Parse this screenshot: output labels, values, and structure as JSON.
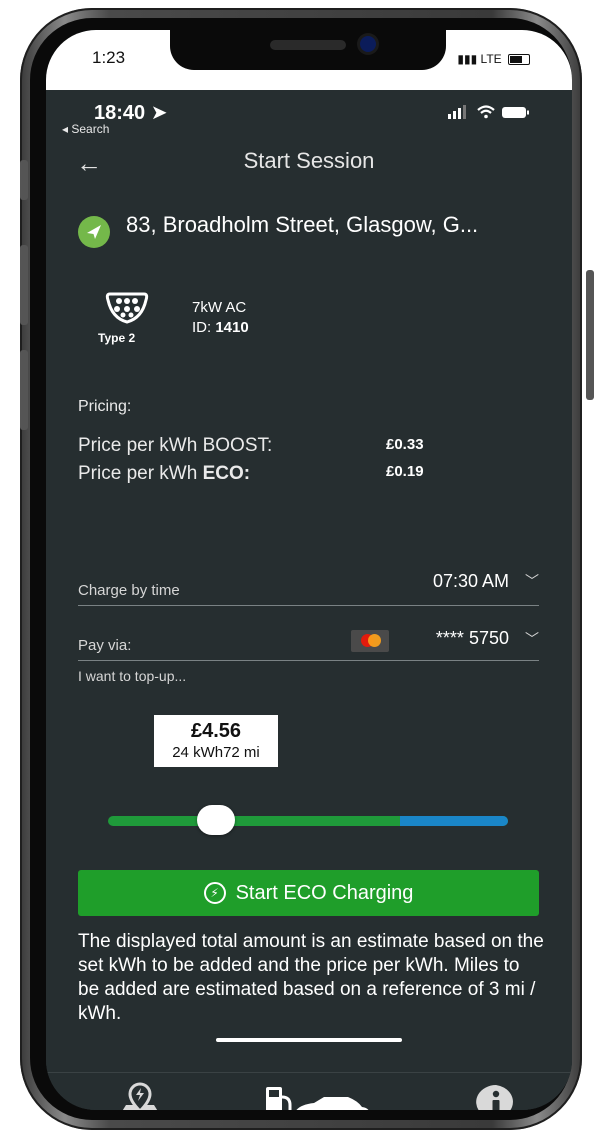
{
  "outer_status": {
    "time": "1:23",
    "right": "LTE"
  },
  "status": {
    "time": "18:40",
    "back_label": "◂ Search"
  },
  "header": {
    "title": "Start Session"
  },
  "location": {
    "address": "83, Broadholm Street, Glasgow, G..."
  },
  "connector": {
    "type_label": "Type 2",
    "power": "7kW AC",
    "id_label": "ID: ",
    "id_value": "1410"
  },
  "pricing": {
    "heading": "Pricing:",
    "boost_label": "Price per kWh BOOST:",
    "boost_value": "£0.33",
    "eco_label_prefix": "Price per kWh ",
    "eco_label_bold": "ECO:",
    "eco_value": "£0.19"
  },
  "charge_by": {
    "label": "Charge by time",
    "value": "07:30 AM"
  },
  "pay_via": {
    "label": "Pay via:",
    "value": "**** 5750",
    "card_icon": "mastercard-icon"
  },
  "topup": {
    "label": "I want to top-up...",
    "amount": "£4.56",
    "kwh": "24 kWh",
    "miles": "72 mi",
    "slider_fraction": 0.27,
    "green_fraction": 0.73
  },
  "cta": {
    "label": "Start ECO Charging"
  },
  "note": "The displayed total amount is an estimate based on the set kWh to be added and the price per kWh. Miles to be added are estimated based on a reference of 3 mi / kWh.",
  "tabs": [
    {
      "icon": "map-pin-icon"
    },
    {
      "icon": "charging-car-icon"
    },
    {
      "icon": "info-icon"
    }
  ],
  "colors": {
    "background": "#262e30",
    "green": "#1f9e2a",
    "blue": "#1a86c8",
    "location_green": "#74b84a"
  }
}
